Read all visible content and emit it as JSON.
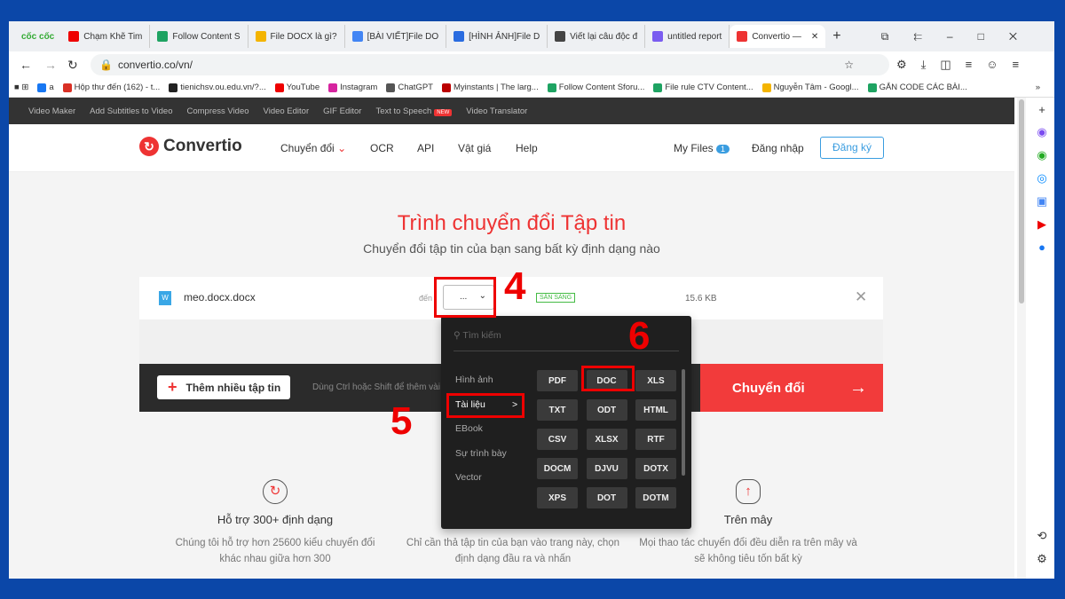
{
  "browser": {
    "tabs": [
      {
        "label": "Chạm Khẽ Tim",
        "color": "#e00"
      },
      {
        "label": "Follow Content S",
        "color": "#1ea362"
      },
      {
        "label": "File DOCX là gì?",
        "color": "#f4b400"
      },
      {
        "label": "[BÀI VIẾT]File DO",
        "color": "#4285f4"
      },
      {
        "label": "[HÌNH ẢNH]File D",
        "color": "#2a6ce0"
      },
      {
        "label": "Viết lại câu độc đ",
        "color": "#444"
      },
      {
        "label": "untitled report",
        "color": "#7a5cf0"
      },
      {
        "label": "Convertio —",
        "color": "#e33"
      }
    ],
    "brand": "cốc cốc",
    "url": "convertio.co/vn/",
    "bookmarks": [
      {
        "label": "a",
        "color": "#1877f2"
      },
      {
        "label": "Hộp thư đến (162) - t...",
        "color": "#d93025"
      },
      {
        "label": "tienichsv.ou.edu.vn/?...",
        "color": "#222"
      },
      {
        "label": "YouTube",
        "color": "#e00"
      },
      {
        "label": "Instagram",
        "color": "#d6249f"
      },
      {
        "label": "ChatGPT",
        "color": "#555"
      },
      {
        "label": "Myinstants | The larg...",
        "color": "#b00"
      },
      {
        "label": "Follow Content Sforu...",
        "color": "#1ea362"
      },
      {
        "label": "File rule CTV Content...",
        "color": "#1ea362"
      },
      {
        "label": "Nguyễn Tâm - Googl...",
        "color": "#f4b400"
      },
      {
        "label": "GẮN CODE CÁC BÀI...",
        "color": "#1ea362"
      }
    ]
  },
  "site": {
    "toolbar": [
      "Video Maker",
      "Add Subtitles to Video",
      "Compress Video",
      "Video Editor",
      "GIF Editor",
      "Text to Speech",
      "Video Translator"
    ],
    "new_badge": "NEW",
    "logo": "Convertio",
    "nav": {
      "convert": "Chuyển đổi",
      "ocr": "OCR",
      "api": "API",
      "pricing": "Vật giá",
      "help": "Help",
      "myfiles": "My Files",
      "myfiles_count": "1",
      "login": "Đăng nhập",
      "signup": "Đăng ký"
    },
    "title": "Trình chuyển đổi Tập tin",
    "subtitle": "Chuyển đổi tập tin của bạn sang bất kỳ định dạng nào",
    "file": {
      "name": "meo.docx.docx",
      "to_label": "đến",
      "format_value": "...",
      "status": "SẴN SÀNG",
      "size": "15.6 KB"
    },
    "add_more": "Thêm nhiều tập tin",
    "hint": "Dùng Ctrl hoặc Shift để thêm vài",
    "convert_btn": "Chuyển đổi",
    "dropdown": {
      "search_placeholder": "Tìm kiếm",
      "categories": [
        "Hình ảnh",
        "Tài liệu",
        "EBook",
        "Sự trình bày",
        "Vector"
      ],
      "formats": [
        "PDF",
        "DOC",
        "XLS",
        "TXT",
        "ODT",
        "HTML",
        "CSV",
        "XLSX",
        "RTF",
        "DOCM",
        "DJVU",
        "DOTX",
        "XPS",
        "DOT",
        "DOTM"
      ]
    },
    "features": [
      {
        "title": "Hỗ trợ 300+ định dạng",
        "desc": "Chúng tôi hỗ trợ hơn 25600 kiểu chuyển đổi khác nhau giữa hơn 300"
      },
      {
        "title": "Nhanh và dễ dàng",
        "desc": "Chỉ cần thả tập tin của bạn vào trang này, chọn định dạng đầu ra và nhấn"
      },
      {
        "title": "Trên mây",
        "desc": "Mọi thao tác chuyển đổi đều diễn ra trên mây và sẽ không tiêu tốn bất kỳ"
      }
    ]
  },
  "annotations": [
    "4",
    "5",
    "6"
  ]
}
